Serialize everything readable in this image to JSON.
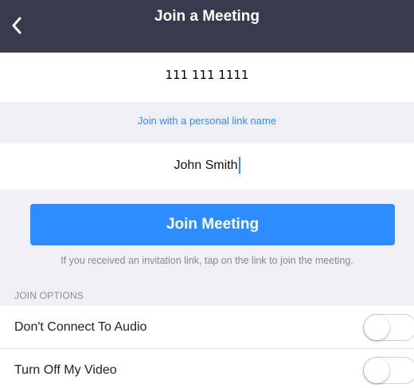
{
  "header": {
    "title": "Join a Meeting",
    "back_icon": "chevron-left-icon"
  },
  "meeting_id": {
    "value": "111 111 1111"
  },
  "personal_link": {
    "label": "Join with a personal link name"
  },
  "name_field": {
    "value": "John Smith"
  },
  "join_button": {
    "label": "Join Meeting"
  },
  "invite_hint": "If you received an invitation link, tap on the link to join the meeting.",
  "options": {
    "heading": "JOIN OPTIONS",
    "items": [
      {
        "label": "Don't Connect To Audio",
        "enabled": false
      },
      {
        "label": "Turn Off My Video",
        "enabled": false
      }
    ]
  },
  "colors": {
    "header_bg": "#3a3a4f",
    "accent": "#2d8cff",
    "page_bg": "#f0f0f4"
  }
}
